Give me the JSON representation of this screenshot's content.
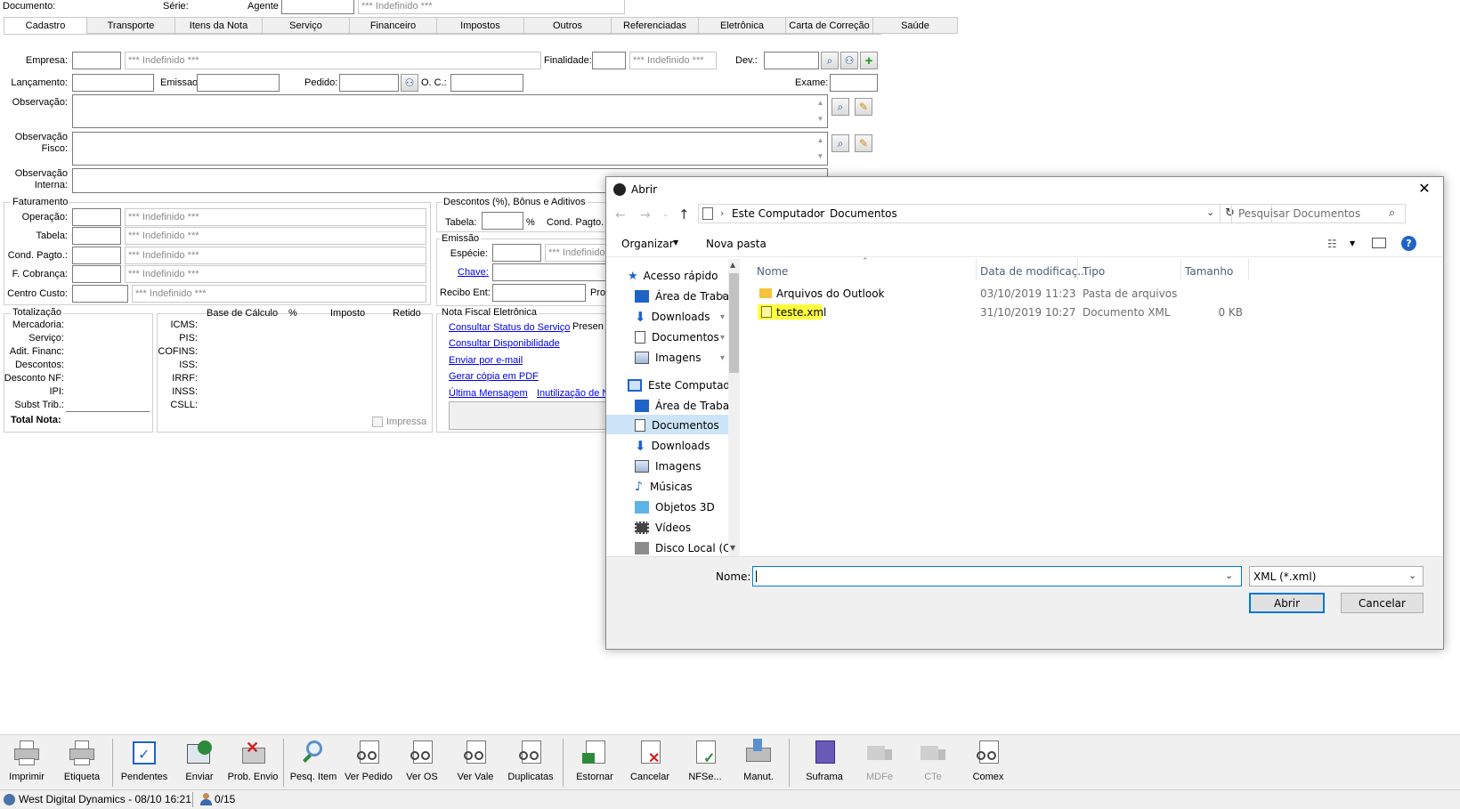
{
  "header": {
    "documento_label": "Documento:",
    "serie_label": "Série:",
    "agente_label": "Agente",
    "agente_value": "*** Indefinido ***"
  },
  "tabs": [
    "Cadastro",
    "Transporte",
    "Itens da Nota",
    "Serviço",
    "Financeiro",
    "Impostos",
    "Outros",
    "Referenciadas",
    "Eletrônica",
    "Carta de Correção",
    "Saúde"
  ],
  "form": {
    "empresa_label": "Empresa:",
    "empresa_value": "*** Indefinido ***",
    "finalidade_label": "Finalidade:",
    "finalidade_value": "*** Indefinido ***",
    "dev_label": "Dev.:",
    "lancamento_label": "Lançamento:",
    "emissao_label": "Emissao",
    "pedido_label": "Pedido:",
    "oc_label": "O. C.:",
    "exame_label": "Exame:",
    "observacao_label": "Observação:",
    "obs_fisco_label1": "Observação",
    "obs_fisco_label2": "Fisco:",
    "obs_interna_label1": "Observação",
    "obs_interna_label2": "Interna:"
  },
  "faturamento": {
    "title": "Faturamento",
    "rows": [
      {
        "label": "Operação:",
        "value": "*** Indefinido ***"
      },
      {
        "label": "Tabela:",
        "value": "*** Indefinido ***"
      },
      {
        "label": "Cond. Pagto.:",
        "value": "*** Indefinido ***"
      },
      {
        "label": "F. Cobrança:",
        "value": "*** Indefinido ***"
      }
    ],
    "centro_label": "Centro Custo:",
    "centro_value": "*** Indefinido ***"
  },
  "descontos": {
    "title": "Descontos (%), Bônus e Aditivos",
    "tabela_label": "Tabela:",
    "pct": "%",
    "cond_label": "Cond. Pagto."
  },
  "emissao_box": {
    "title": "Emissão",
    "especie_label": "Espécie:",
    "especie_value": "*** Indefinido",
    "chave_label": "Chave:",
    "recibo_label": "Recibo Ent:",
    "pro_label": "Pro"
  },
  "totalizacao": {
    "title": "Totalização",
    "labels": [
      "Mercadoria:",
      "Serviço:",
      "Adit. Financ:",
      "Descontos:",
      "Desconto NF:",
      "IPI:",
      "Subst Trib.:"
    ],
    "total_label": "Total Nota:"
  },
  "impostos": {
    "headers": [
      "Base de Cálculo",
      "%",
      "Imposto",
      "Retido"
    ],
    "labels": [
      "ICMS:",
      "PIS:",
      "COFINS:",
      "ISS:",
      "IRRF:",
      "INSS:",
      "CSLL:"
    ],
    "impressa_label": "Impressa"
  },
  "nfe": {
    "title": "Nota Fiscal Eletrônica",
    "consultar_status": "Consultar Status do Serviço",
    "presen": "Presen",
    "consultar_disp": "Consultar Disponibilidade",
    "enviar_email": "Enviar por e-mail",
    "gerar_pdf": "Gerar cópia em PDF",
    "ultima_msg": "Última Mensagem",
    "inutilizacao": "Inutilização de N"
  },
  "toolbar": [
    {
      "label": "Imprimir",
      "icon": "printer-icon"
    },
    {
      "label": "Etiqueta",
      "icon": "label-printer-icon"
    },
    {
      "label": "Pendentes",
      "icon": "pending-check-icon"
    },
    {
      "label": "Enviar",
      "icon": "send-globe-icon"
    },
    {
      "label": "Prob. Envio",
      "icon": "send-problem-icon"
    },
    {
      "label": "Pesq. Item",
      "icon": "search-item-icon"
    },
    {
      "label": "Ver Pedido",
      "icon": "view-order-icon"
    },
    {
      "label": "Ver OS",
      "icon": "view-os-icon"
    },
    {
      "label": "Ver Vale",
      "icon": "view-voucher-icon"
    },
    {
      "label": "Duplicatas",
      "icon": "duplicates-icon"
    },
    {
      "label": "Estornar",
      "icon": "reverse-icon"
    },
    {
      "label": "Cancelar",
      "icon": "cancel-doc-icon"
    },
    {
      "label": "NFSe...",
      "icon": "nfse-icon"
    },
    {
      "label": "Manut.",
      "icon": "maintenance-icon"
    },
    {
      "label": "Suframa",
      "icon": "suframa-icon"
    },
    {
      "label": "MDFe",
      "icon": "truck-icon"
    },
    {
      "label": "CTe",
      "icon": "truck-cte-icon"
    },
    {
      "label": "Comex",
      "icon": "comex-icon"
    }
  ],
  "status": {
    "text": "West Digital Dynamics - 08/10 16:21",
    "count": "0/15"
  },
  "dialog": {
    "title": "Abrir",
    "path": [
      "Este Computador",
      "Documentos"
    ],
    "search_placeholder": "Pesquisar Documentos",
    "organizar": "Organizar",
    "nova_pasta": "Nova pasta",
    "nav": [
      {
        "label": "Acesso rápido",
        "icon": "star-icon",
        "pin": false
      },
      {
        "label": "Área de Traba",
        "icon": "desktop-icon",
        "pin": true
      },
      {
        "label": "Downloads",
        "icon": "download-arrow-icon",
        "pin": true
      },
      {
        "label": "Documentos",
        "icon": "document-icon",
        "pin": true
      },
      {
        "label": "Imagens",
        "icon": "image-icon",
        "pin": true
      },
      {
        "label": "Este Computador",
        "icon": "computer-icon",
        "pin": false
      },
      {
        "label": "Área de Trabalho",
        "icon": "desktop-icon",
        "pin": false
      },
      {
        "label": "Documentos",
        "icon": "document-icon",
        "pin": false
      },
      {
        "label": "Downloads",
        "icon": "download-arrow-icon",
        "pin": false
      },
      {
        "label": "Imagens",
        "icon": "image-icon",
        "pin": false
      },
      {
        "label": "Músicas",
        "icon": "music-note-icon",
        "pin": false
      },
      {
        "label": "Objetos 3D",
        "icon": "cube-icon",
        "pin": false
      },
      {
        "label": "Vídeos",
        "icon": "film-icon",
        "pin": false
      },
      {
        "label": "Disco Local (C:)",
        "icon": "disk-icon",
        "pin": false
      }
    ],
    "columns": [
      "Nome",
      "Data de modificaç...",
      "Tipo",
      "Tamanho"
    ],
    "files": [
      {
        "name": "Arquivos do Outlook",
        "date": "03/10/2019 11:23",
        "type": "Pasta de arquivos",
        "size": ""
      },
      {
        "name": "teste.xml",
        "date": "31/10/2019 10:27",
        "type": "Documento XML",
        "size": "0 KB"
      }
    ],
    "nome_label": "Nome:",
    "filter": "XML (*.xml)",
    "open_label": "Abrir",
    "cancel_label": "Cancelar"
  }
}
